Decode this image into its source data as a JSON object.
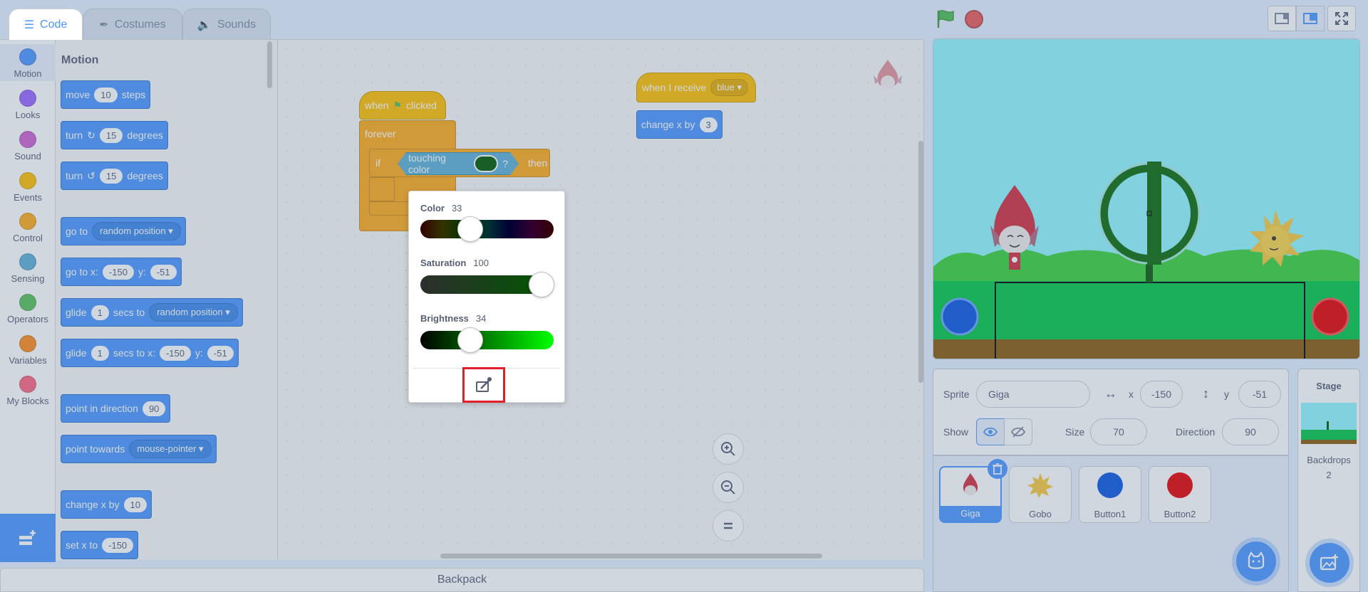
{
  "tabs": [
    {
      "label": "Code",
      "icon": "code-icon"
    },
    {
      "label": "Costumes",
      "icon": "brush-icon"
    },
    {
      "label": "Sounds",
      "icon": "speaker-icon"
    }
  ],
  "categories": [
    {
      "label": "Motion",
      "color": "#4c97ff"
    },
    {
      "label": "Looks",
      "color": "#9966ff"
    },
    {
      "label": "Sound",
      "color": "#cf63cf"
    },
    {
      "label": "Events",
      "color": "#ffbf00"
    },
    {
      "label": "Control",
      "color": "#ffab19"
    },
    {
      "label": "Sensing",
      "color": "#5cb1d6"
    },
    {
      "label": "Operators",
      "color": "#59c059"
    },
    {
      "label": "Variables",
      "color": "#ff8c1a"
    },
    {
      "label": "My Blocks",
      "color": "#ff6680"
    }
  ],
  "palette": {
    "title": "Motion",
    "move": {
      "a": "move",
      "v": "10",
      "b": "steps"
    },
    "turn_right": {
      "a": "turn",
      "v": "15",
      "b": "degrees"
    },
    "turn_left": {
      "a": "turn",
      "v": "15",
      "b": "degrees"
    },
    "goto": {
      "a": "go to",
      "d": "random position"
    },
    "gotoxy": {
      "a": "go to x:",
      "x": "-150",
      "b": "y:",
      "y": "-51"
    },
    "glide1": {
      "a": "glide",
      "v": "1",
      "b": "secs to",
      "d": "random position"
    },
    "glide2": {
      "a": "glide",
      "v": "1",
      "b": "secs to x:",
      "x": "-150",
      "c": "y:",
      "y": "-51"
    },
    "point_dir": {
      "a": "point in direction",
      "v": "90"
    },
    "point_towards": {
      "a": "point towards",
      "d": "mouse-pointer"
    },
    "changex": {
      "a": "change x by",
      "v": "10"
    },
    "setx": {
      "a": "set x to",
      "v": "-150"
    }
  },
  "script1": {
    "hat_a": "when",
    "hat_b": "clicked",
    "forever": "forever",
    "if": "if",
    "touching": "touching color",
    "q": "?",
    "then": "then"
  },
  "script2": {
    "hat": "when I receive",
    "msg": "blue",
    "change": "change x by",
    "v": "3"
  },
  "picker": {
    "color_label": "Color",
    "color_value": "33",
    "saturation_label": "Saturation",
    "saturation_value": "100",
    "brightness_label": "Brightness",
    "brightness_value": "34",
    "selected_color": "#005700"
  },
  "backpack": "Backpack",
  "sprite_info": {
    "sprite_label": "Sprite",
    "sprite_name": "Giga",
    "x_label": "x",
    "x": "-150",
    "y_label": "y",
    "y": "-51",
    "show_label": "Show",
    "size_label": "Size",
    "size": "70",
    "direction_label": "Direction",
    "direction": "90"
  },
  "sprites": [
    {
      "name": "Giga"
    },
    {
      "name": "Gobo"
    },
    {
      "name": "Button1"
    },
    {
      "name": "Button2"
    }
  ],
  "stage_panel": {
    "title": "Stage",
    "backdrops_label": "Backdrops",
    "backdrops_count": "2"
  }
}
